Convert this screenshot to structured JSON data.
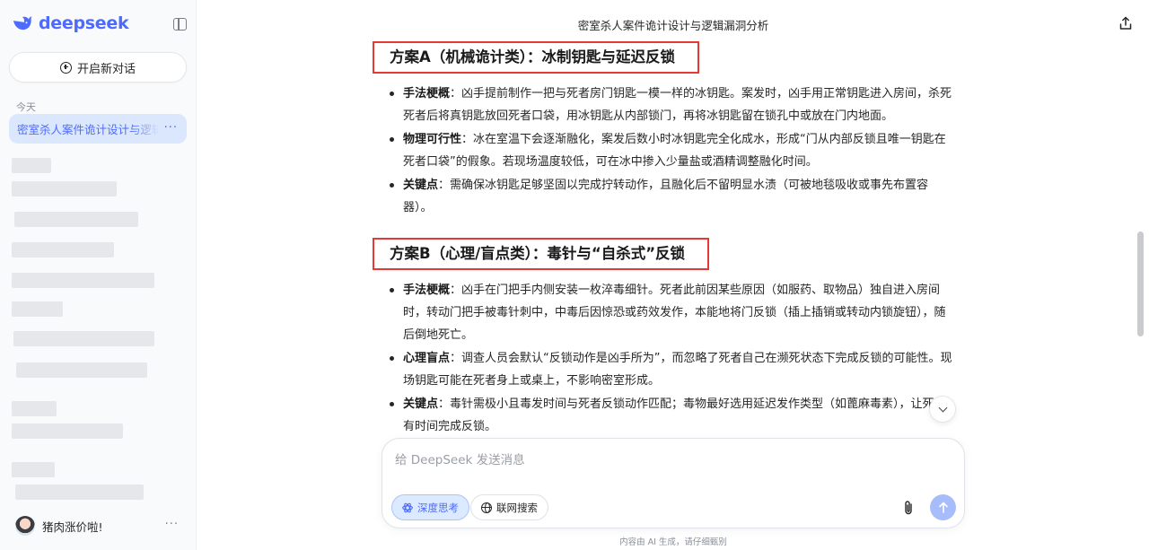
{
  "sidebar": {
    "brand": "deepseek",
    "new_chat_label": "开启新对话",
    "section_today": "今天",
    "active_chat": "密室杀人案件诡计设计与逻辑漏洞分析",
    "more_glyph": "···",
    "user_name": "猪肉涨价啦!"
  },
  "header": {
    "title": "密室杀人案件诡计设计与逻辑漏洞分析"
  },
  "content": {
    "scheme_a": {
      "title": "方案A（机械诡计类）：冰制钥匙与延迟反锁",
      "items": [
        {
          "label": "手法梗概",
          "text": "：凶手提前制作一把与死者房门钥匙一模一样的冰钥匙。案发时，凶手用正常钥匙进入房间，杀死死者后将真钥匙放回死者口袋，用冰钥匙从内部锁门，再将冰钥匙留在锁孔中或放在门内地面。"
        },
        {
          "label": "物理可行性",
          "text": "：冰在室温下会逐渐融化，案发后数小时冰钥匙完全化成水，形成“门从内部反锁且唯一钥匙在死者口袋”的假象。若现场温度较低，可在冰中掺入少量盐或酒精调整融化时间。"
        },
        {
          "label": "关键点",
          "text": "：需确保冰钥匙足够坚固以完成拧转动作，且融化后不留明显水渍（可被地毯吸收或事先布置容器）。"
        }
      ]
    },
    "scheme_b": {
      "title": "方案B（心理/盲点类）：毒针与“自杀式”反锁",
      "items": [
        {
          "label": "手法梗概",
          "text": "：凶手在门把手内侧安装一枚淬毒细针。死者此前因某些原因（如服药、取物品）独自进入房间时，转动门把手被毒针刺中，中毒后因惊恐或药效发作，本能地将门反锁（插上插销或转动内锁旋钮），随后倒地死亡。"
        },
        {
          "label": "心理盲点",
          "text": "：调查人员会默认“反锁动作是凶手所为”，而忽略了死者自己在濒死状态下完成反锁的可能性。现场钥匙可能在死者身上或桌上，不影响密室形成。"
        },
        {
          "label": "关键点",
          "text": "：毒针需极小且毒发时间与死者反锁动作匹配；毒物最好选用延迟发作类型（如蓖麻毒素），让死者有时间完成反锁。"
        }
      ]
    }
  },
  "composer": {
    "placeholder": "给 DeepSeek 发送消息",
    "deep_think_label": "深度思考",
    "web_search_label": "联网搜索",
    "footnote": "内容由 AI 生成，请仔细甄别"
  },
  "colors": {
    "brand": "#4d6bfe",
    "highlight_border": "#e53935",
    "active_chat_bg": "#dbe7fc"
  }
}
